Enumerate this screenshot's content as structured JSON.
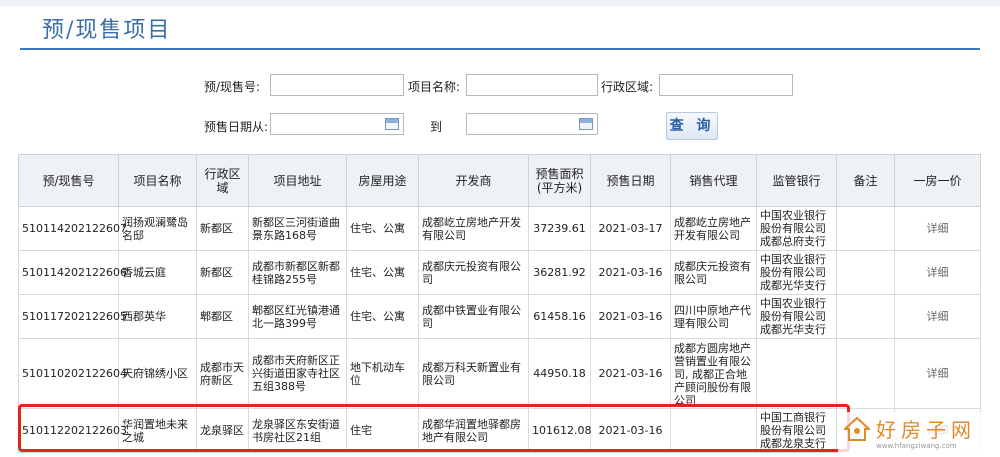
{
  "header": {
    "title": "预/现售项目"
  },
  "search": {
    "presale_no_label": "预/现售号:",
    "project_name_label": "项目名称:",
    "district_label": "行政区域:",
    "date_from_label": "预售日期从:",
    "date_to_label": "到",
    "query_button": "查 询"
  },
  "table": {
    "columns": [
      "预/现售号",
      "项目名称",
      "行政区域",
      "项目地址",
      "房屋用途",
      "开发商",
      "预售面积\n(平方米)",
      "预售日期",
      "销售代理",
      "监管银行",
      "备注",
      "一房一价"
    ],
    "rows": [
      [
        "510114202122607",
        "润扬观澜鹭岛名邸",
        "新都区",
        "新都区三河街道曲景东路168号",
        "住宅、公寓",
        "成都屹立房地产开发有限公司",
        "37239.61",
        "2021-03-17",
        "成都屹立房地产开发有限公司",
        "中国农业银行股份有限公司成都总府支行",
        "",
        "详细"
      ],
      [
        "510114202122606",
        "香城云庭",
        "新都区",
        "成都市新都区新都桂锦路255号",
        "住宅、公寓",
        "成都庆元投资有限公司",
        "36281.92",
        "2021-03-16",
        "成都庆元投资有限公司",
        "中国农业银行股份有限公司成都光华支行",
        "",
        "详细"
      ],
      [
        "510117202122605",
        "西郡英华",
        "郫都区",
        "郫都区红光镇港通北一路399号",
        "住宅、公寓",
        "成都中铁置业有限公司",
        "61458.16",
        "2021-03-16",
        "四川中原地产代理有限公司",
        "中国农业银行股份有限公司成都光华支行",
        "",
        "详细"
      ],
      [
        "510110202122604",
        "天府锦绣小区",
        "成都市天府新区",
        "成都市天府新区正兴街道田家寺社区五组388号",
        "地下机动车位",
        "成都万科天新置业有限公司",
        "44950.18",
        "2021-03-16",
        "成都方圆房地产营销置业有限公司, 成都正合地产顾问股份有限公司",
        "",
        "",
        "详细"
      ],
      [
        "510112202122603",
        "华润置地未来之城",
        "龙泉驿区",
        "龙泉驿区东安街道书房社区21组",
        "住宅",
        "成都华润置地驿都房地产有限公司",
        "101612.08",
        "2021-03-16",
        "",
        "中国工商银行股份有限公司成都龙泉支行",
        "",
        "详细"
      ]
    ]
  },
  "watermark": {
    "brand": "好房子网",
    "url": "www.hfangziwang.com"
  },
  "colors": {
    "title": "#3a6ea8",
    "highlight": "#e3231c",
    "header_bg": "#eef1f5"
  }
}
